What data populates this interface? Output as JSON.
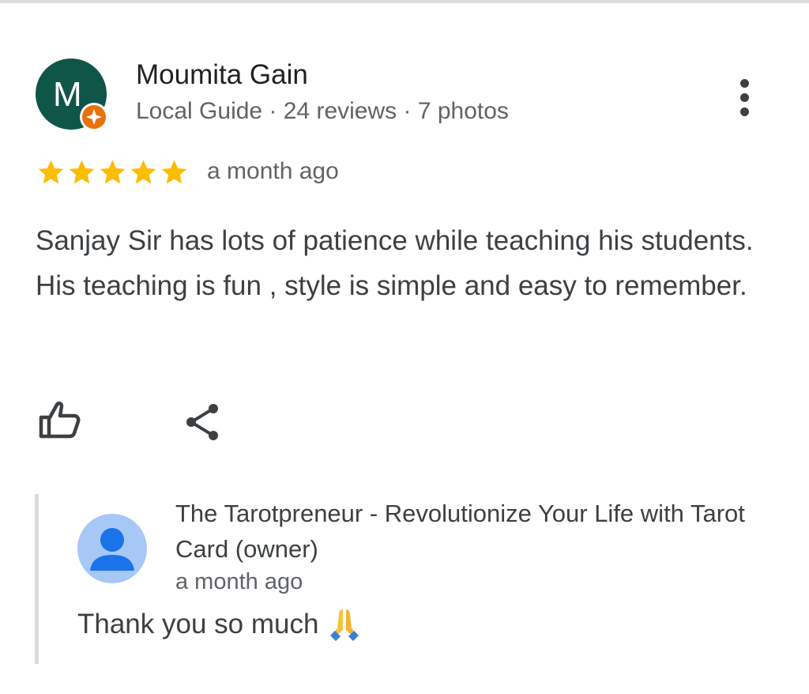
{
  "review": {
    "author": {
      "initial": "M",
      "name": "Moumita Gain",
      "meta": "Local Guide · 24 reviews · 7 photos",
      "avatar_color": "#0f5548",
      "badge_color": "#e8710a"
    },
    "menu_icon": "more-vert-icon",
    "rating": 5,
    "star_color": "#fbbc04",
    "date": "a month ago",
    "text": "Sanjay Sir has lots of patience while teaching his students. His teaching is fun , style is simple and easy to remember.",
    "actions": {
      "like_icon": "thumb-up-icon",
      "share_icon": "share-icon"
    }
  },
  "owner_response": {
    "name": "The Tarotpreneur - Revolutionize Your Life with Tarot Card (owner)",
    "date": "a month ago",
    "text": "Thank you so much",
    "emoji_icon": "folded-hands-icon",
    "avatar_color": "#a7c7f7"
  }
}
